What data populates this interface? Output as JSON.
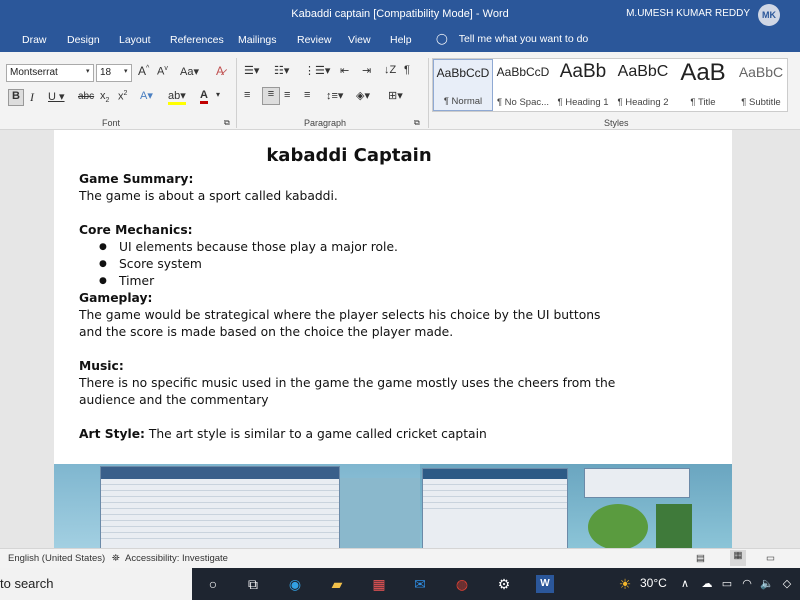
{
  "window": {
    "title": "Kabaddi captain [Compatibility Mode]  -  Word",
    "user_name": "M.UMESH KUMAR REDDY",
    "user_initials": "MK"
  },
  "ribbon_tabs": [
    "Draw",
    "Design",
    "Layout",
    "References",
    "Mailings",
    "Review",
    "View",
    "Help"
  ],
  "tell_me": "Tell me what you want to do",
  "font": {
    "name": "Montserrat",
    "size": "18",
    "group_label": "Font"
  },
  "paragraph_group_label": "Paragraph",
  "styles": {
    "group_label": "Styles",
    "items": [
      {
        "sample": "AaBbCcD",
        "name": "¶ Normal"
      },
      {
        "sample": "AaBbCcD",
        "name": "¶ No Spac..."
      },
      {
        "sample": "AaBb",
        "name": "¶ Heading 1"
      },
      {
        "sample": "AaBbC",
        "name": "¶ Heading 2"
      },
      {
        "sample": "AaB",
        "name": "¶ Title"
      },
      {
        "sample": "AaBbC",
        "name": "¶ Subtitle"
      }
    ]
  },
  "document": {
    "title": "kabaddi Captain",
    "game_summary_heading": "Game Summary:",
    "game_summary_text": "The game is about a sport called kabaddi.",
    "core_heading": "Core Mechanics:",
    "core_items": [
      "UI elements because those play a major role.",
      "Score system",
      "Timer"
    ],
    "gameplay_heading": "Gameplay:",
    "gameplay_text": "The game would be strategical where the player selects his choice by the UI buttons and the score is made based on the choice the player made.",
    "music_heading": "Music:",
    "music_text": "There is no specific music used in the game the game mostly uses the cheers from the audience and the commentary",
    "art_heading": "Art Style:",
    "art_text": " The art style is similar to a game called cricket captain"
  },
  "statusbar": {
    "language": "English (United States)",
    "accessibility": "Accessibility: Investigate"
  },
  "taskbar": {
    "search_text": "to search",
    "temperature": "30°C"
  },
  "colors": {
    "word_blue": "#2b579a",
    "font_color_red": "#c00000",
    "highlight_yellow": "#ffff00"
  }
}
